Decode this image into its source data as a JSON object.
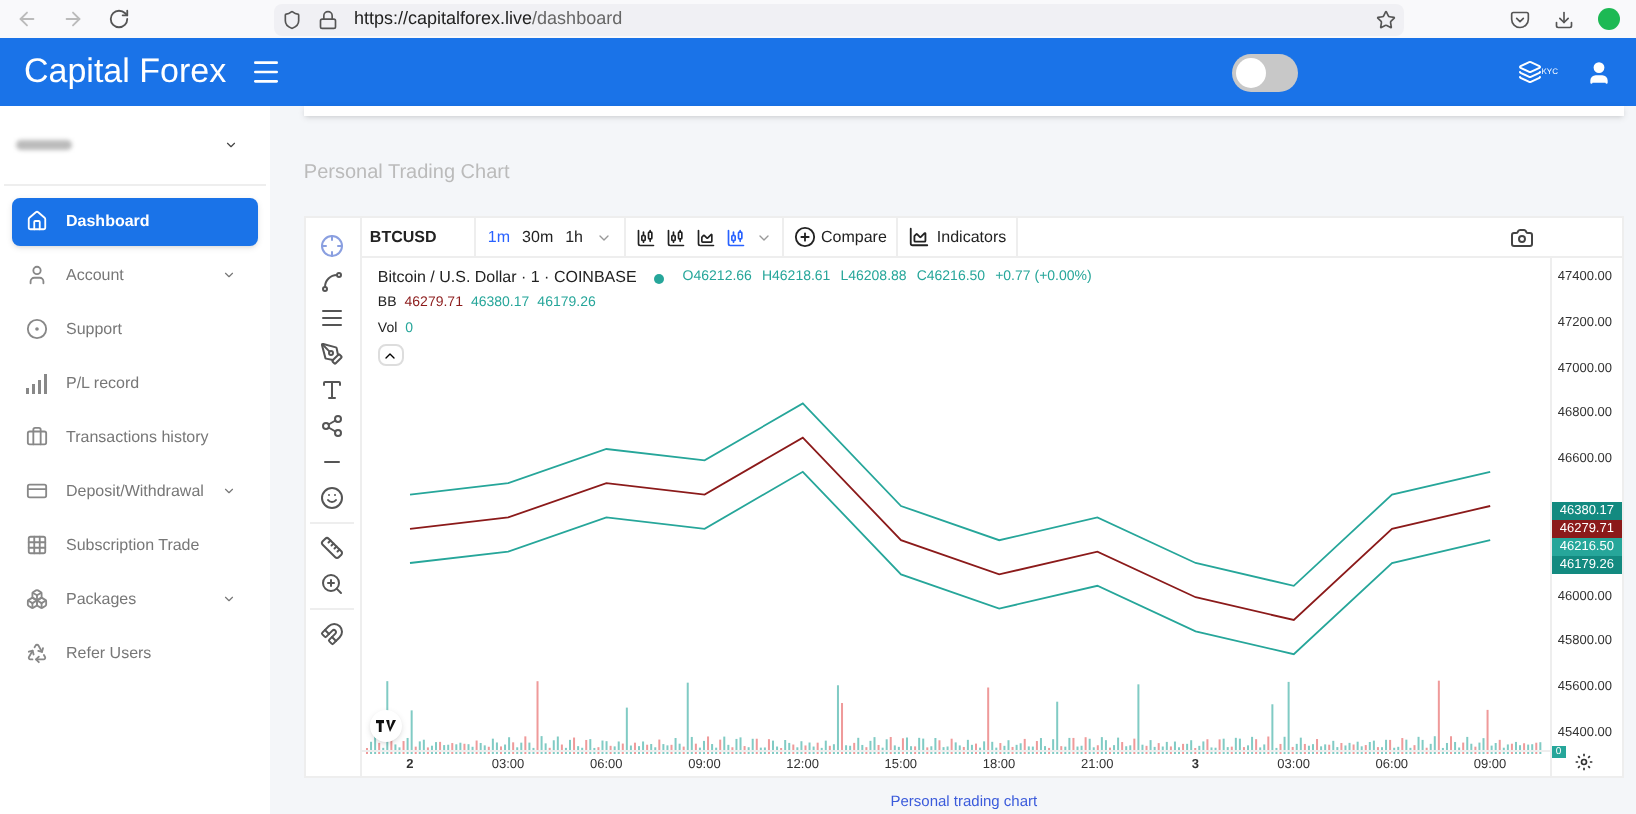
{
  "browser": {
    "url_host": "https://capitalforex.live",
    "url_path": "/dashboard"
  },
  "header": {
    "brand": "Capital Forex",
    "theme_toggle": {
      "on": false
    },
    "kyc_label": "KYC"
  },
  "sidebar": {
    "items": [
      {
        "label": "Dashboard",
        "selected": true,
        "kind": "link"
      },
      {
        "label": "Account",
        "selected": false,
        "kind": "dropdown"
      },
      {
        "label": "Support",
        "selected": false,
        "kind": "link"
      },
      {
        "label": "P/L record",
        "selected": false,
        "kind": "link"
      },
      {
        "label": "Transactions history",
        "selected": false,
        "kind": "link"
      },
      {
        "label": "Deposit/Withdrawal",
        "selected": false,
        "kind": "dropdown"
      },
      {
        "label": "Subscription Trade",
        "selected": false,
        "kind": "link"
      },
      {
        "label": "Packages",
        "selected": false,
        "kind": "dropdown"
      },
      {
        "label": "Refer Users",
        "selected": false,
        "kind": "link"
      }
    ]
  },
  "page_title": "Personal Trading Chart",
  "chart": {
    "symbol": "BTCUSD",
    "intervals": [
      {
        "label": "1m",
        "selected": true
      },
      {
        "label": "30m",
        "selected": false
      },
      {
        "label": "1h",
        "selected": false
      }
    ],
    "compare": "Compare",
    "indicators": "Indicators",
    "legend_title": "Bitcoin / U.S. Dollar · 1 · COINBASE",
    "ohlc": [
      "O46212.66",
      "H46218.61",
      "L46208.88",
      "C46216.50",
      "+0.77 (+0.00%)"
    ],
    "bb_label": "BB",
    "bb_values": [
      {
        "text": "46279.71",
        "color": "#8b1a1a"
      },
      {
        "text": "46380.17",
        "color": "#26a69a"
      },
      {
        "text": "46179.26",
        "color": "#26a69a"
      }
    ],
    "vol_label": "Vol",
    "vol_value": "0",
    "price_labels": [
      {
        "text": "46380.17",
        "color": "#138a80"
      },
      {
        "text": "46279.71",
        "color": "#8b1a1a"
      },
      {
        "text": "46216.50",
        "color": "#26a69a"
      },
      {
        "text": "46179.26",
        "color": "#138a80"
      }
    ],
    "volume_axis_label": "0",
    "chart_data": {
      "type": "line",
      "categories": [
        "2",
        "03:00",
        "06:00",
        "09:00",
        "12:00",
        "15:00",
        "18:00",
        "21:00",
        "3",
        "03:00",
        "06:00",
        "09:00"
      ],
      "series": [
        {
          "color": "#26a69a",
          "values": [
            46450,
            46500,
            46650,
            46600,
            46850,
            46400,
            46250,
            46350,
            46150,
            46050,
            46450,
            46550
          ]
        },
        {
          "color": "#8b1a1a",
          "values": [
            46300,
            46350,
            46500,
            46450,
            46700,
            46250,
            46100,
            46200,
            46000,
            45900,
            46300,
            46400
          ]
        },
        {
          "color": "#26a69a",
          "values": [
            46150,
            46200,
            46350,
            46300,
            46550,
            46100,
            45950,
            46050,
            45850,
            45750,
            46150,
            46250
          ]
        }
      ],
      "ylim": [
        45312,
        47488
      ],
      "yticks": [
        {
          "value": 47400,
          "label": "47400.00"
        },
        {
          "value": 47200,
          "label": "47200.00"
        },
        {
          "value": 47000,
          "label": "47000.00"
        },
        {
          "value": 46800,
          "label": "46800.00"
        },
        {
          "value": 46600,
          "label": "46600.00"
        },
        {
          "value": 46000,
          "label": "46000.00"
        },
        {
          "value": 45800,
          "label": "45800.00"
        },
        {
          "value": 45600,
          "label": "45600.00"
        },
        {
          "value": 45400,
          "label": "45400.00"
        }
      ]
    },
    "x_tick_styles": [
      {
        "bold": true
      },
      {
        "bold": false
      },
      {
        "bold": false
      },
      {
        "bold": false
      },
      {
        "bold": false
      },
      {
        "bold": false
      },
      {
        "bold": false
      },
      {
        "bold": false
      },
      {
        "bold": true
      },
      {
        "bold": false
      },
      {
        "bold": false
      },
      {
        "bold": false
      }
    ]
  },
  "caption": "Personal trading chart"
}
